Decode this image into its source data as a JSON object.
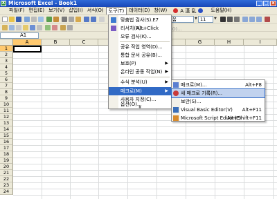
{
  "window": {
    "title": "Microsoft Excel - Book1"
  },
  "menubar": {
    "items": [
      "파일(F)",
      "편집(E)",
      "보기(V)",
      "삽입(I)",
      "서식(O)",
      "도구(T)",
      "데이터(D)",
      "창(W)",
      "도움말(H)"
    ],
    "ime": "A 漢 乱"
  },
  "toolbar": {
    "font_name": "돋움",
    "font_size": "11",
    "ghost_text": "기(O)..."
  },
  "formula_bar": {
    "name_box": "A1"
  },
  "grid": {
    "columns": [
      "A",
      "B",
      "C",
      "D",
      "E",
      "F",
      "G",
      "H",
      "I"
    ],
    "rows": [
      "1",
      "2",
      "3",
      "4",
      "5",
      "6",
      "7",
      "8",
      "9",
      "10",
      "11",
      "12",
      "13",
      "14",
      "15",
      "16",
      "17",
      "18",
      "19",
      "20",
      "21",
      "22",
      "23",
      "24"
    ]
  },
  "tools_menu": {
    "items": [
      {
        "label": "맞춤법 검사(S)...",
        "shortcut": "F7"
      },
      {
        "label": "리서치(R)...",
        "shortcut": "Alt+Click"
      },
      {
        "label": "오류 검사(K)..."
      },
      {
        "label": "공유 작업 영역(D)..."
      },
      {
        "label": "통합 문서 공유(B)..."
      },
      {
        "label": "보호(P)"
      },
      {
        "label": "온라인 공동 작업(N)"
      },
      {
        "label": "수식 분석(U)"
      },
      {
        "label": "매크로(M)"
      },
      {
        "label": "사용자 지정(C)..."
      },
      {
        "label": "옵션(O)..."
      }
    ],
    "more": "¥"
  },
  "macro_menu": {
    "items": [
      {
        "label": "매크로(M)...",
        "shortcut": "Alt+F8"
      },
      {
        "label": "새 매크로 기록(R)..."
      },
      {
        "label": "보안(S)..."
      },
      {
        "label": "Visual Basic Editor(V)",
        "shortcut": "Alt+F11"
      },
      {
        "label": "Microsoft Script Editor(E)",
        "shortcut": "Alt+Shift+F11"
      }
    ]
  },
  "colors": {
    "title": "#1847b8",
    "highlight": "#316ac5",
    "selected": "#c1d2ee",
    "header_selected": "#ffc96f"
  }
}
